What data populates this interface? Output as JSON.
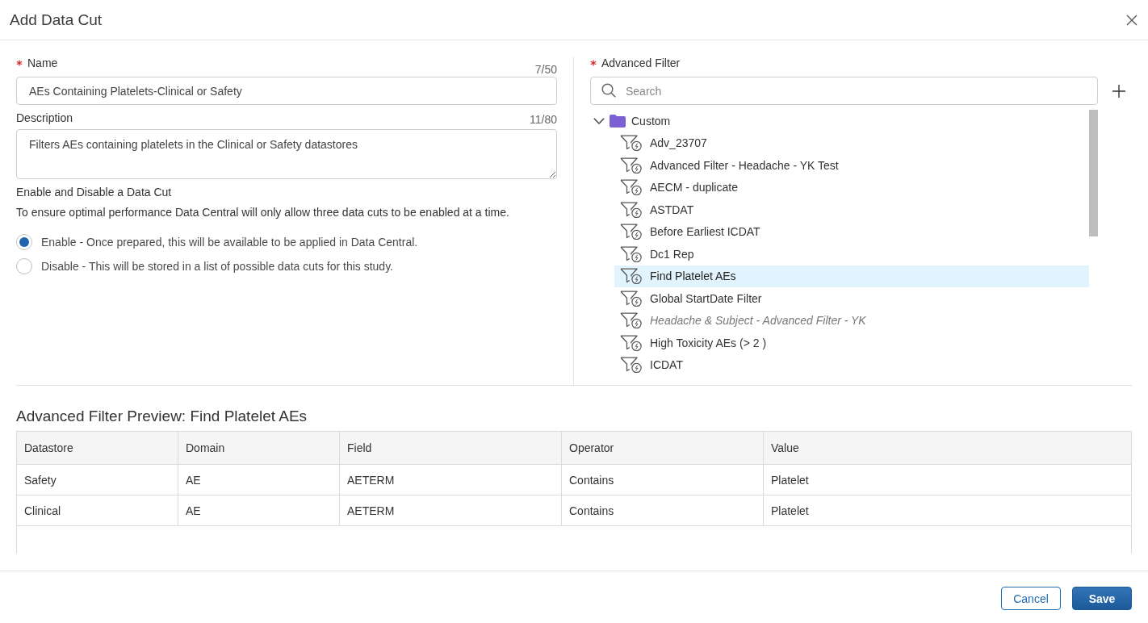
{
  "dialog": {
    "title": "Add Data Cut"
  },
  "name_field": {
    "label": "Name",
    "required": true,
    "counter": "7/50",
    "value": "AEs Containing Platelets-Clinical or Safety"
  },
  "description_field": {
    "label": "Description",
    "counter": "11/80",
    "value": "Filters AEs containing platelets in the Clinical or Safety datastores"
  },
  "enable_section": {
    "heading": "Enable and Disable a Data Cut",
    "info": "To ensure optimal performance Data Central will only allow three data cuts to be enabled at a time.",
    "options": [
      {
        "label": "Enable - Once prepared, this will be available to be applied in Data Central.",
        "selected": true
      },
      {
        "label": "Disable - This will be stored in a list of possible data cuts for this study.",
        "selected": false
      }
    ]
  },
  "advanced_filter": {
    "label": "Advanced Filter",
    "required": true,
    "search": {
      "placeholder": "Search"
    },
    "tree": [
      {
        "label": "Custom",
        "expanded": true,
        "children": [
          {
            "label": "Adv_23707",
            "selected": false,
            "disabled": false
          },
          {
            "label": "Advanced Filter - Headache - YK Test",
            "selected": false,
            "disabled": false
          },
          {
            "label": "AECM - duplicate",
            "selected": false,
            "disabled": false
          },
          {
            "label": "ASTDAT",
            "selected": false,
            "disabled": false
          },
          {
            "label": "Before Earliest ICDAT",
            "selected": false,
            "disabled": false
          },
          {
            "label": "Dc1 Rep",
            "selected": false,
            "disabled": false
          },
          {
            "label": "Find Platelet AEs",
            "selected": true,
            "disabled": false
          },
          {
            "label": "Global StartDate Filter",
            "selected": false,
            "disabled": false
          },
          {
            "label": "Headache & Subject - Advanced Filter - YK",
            "selected": false,
            "disabled": true
          },
          {
            "label": "High Toxicity AEs (> 2 )",
            "selected": false,
            "disabled": false
          },
          {
            "label": "ICDAT",
            "selected": false,
            "disabled": false
          }
        ]
      }
    ]
  },
  "preview": {
    "title": "Advanced Filter Preview: Find Platelet AEs",
    "table": {
      "columns": [
        "Datastore",
        "Domain",
        "Field",
        "Operator",
        "Value"
      ],
      "rows": [
        [
          "Safety",
          "AE",
          "AETERM",
          "Contains",
          "Platelet"
        ],
        [
          "Clinical",
          "AE",
          "AETERM",
          "Contains",
          "Platelet"
        ]
      ]
    }
  },
  "buttons": [
    {
      "label": "Cancel",
      "kind": "secondary"
    },
    {
      "label": "Save",
      "kind": "primary"
    }
  ]
}
